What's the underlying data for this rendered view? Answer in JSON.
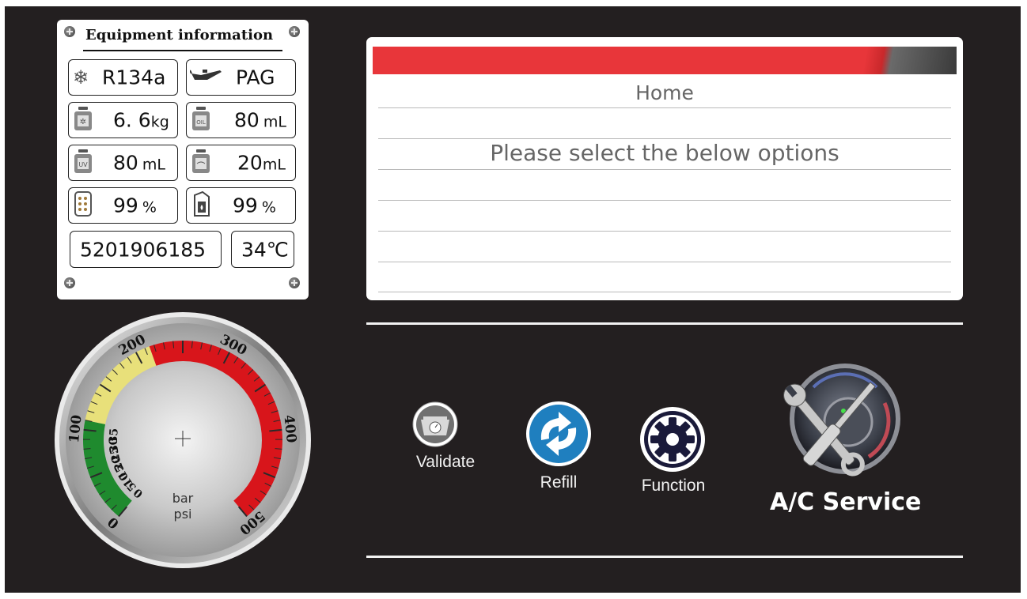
{
  "equipment": {
    "title": "Equipment information",
    "refrigerant": {
      "icon": "snowflake-icon",
      "value": "R134a"
    },
    "oil": {
      "icon": "oil-can-icon",
      "value": "PAG"
    },
    "refrigerant_weight": {
      "icon": "refrigerant-scale-icon",
      "value": "6. 6",
      "unit": "kg"
    },
    "oil_volume": {
      "icon": "oil-scale-icon",
      "value": "80",
      "unit": "mL"
    },
    "uv_volume": {
      "icon": "uv-scale-icon",
      "value": "80",
      "unit": "mL"
    },
    "tank_volume": {
      "icon": "tank-scale-icon",
      "value": "20",
      "unit": "mL"
    },
    "filter_level": {
      "icon": "filter-icon",
      "value": "99",
      "unit": "%"
    },
    "oil_bottle_level": {
      "icon": "oil-bottle-icon",
      "value": "99",
      "unit": "%"
    },
    "serial": "5201906185",
    "temperature": "34℃"
  },
  "message": {
    "title": "Home",
    "text": "Please select the below options"
  },
  "gauge": {
    "units_top": "bar",
    "units_bottom": "psi",
    "psi_labels": [
      "0",
      "100",
      "200",
      "300",
      "400",
      "500"
    ],
    "bar_labels": [
      "0",
      "5",
      "10",
      "15",
      "20",
      "25",
      "30",
      "35"
    ],
    "colors": {
      "green": "#1f8a2e",
      "yellow": "#e8e07a",
      "red": "#d8151b"
    }
  },
  "buttons": {
    "validate": {
      "label": "Validate",
      "icon": "scale-icon"
    },
    "refill": {
      "label": "Refill",
      "icon": "recycle-arrows-icon"
    },
    "function": {
      "label": "Function",
      "icon": "gear-icon"
    },
    "ac_service": {
      "label": "A/C Service",
      "icon": "tools-gauge-icon"
    }
  },
  "colors": {
    "screen_bg": "#231f20",
    "accent_red": "#e8363a"
  }
}
